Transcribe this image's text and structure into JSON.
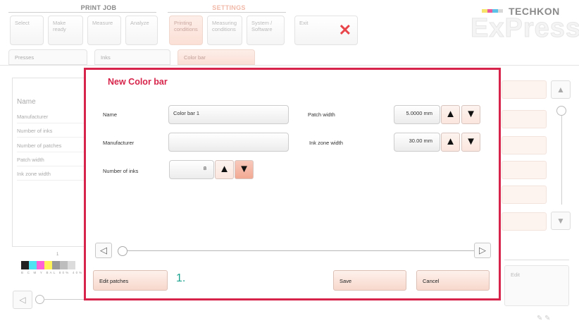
{
  "menu": {
    "print_job_title": "PRINT JOB",
    "settings_title": "SETTINGS",
    "print_job_items": [
      "Select",
      "Make ready",
      "Measure",
      "Analyze"
    ],
    "settings_items": [
      "Printing conditions",
      "Measuring conditions",
      "System / Software"
    ],
    "exit_label": "Exit"
  },
  "logo": {
    "brand": "TECHKON",
    "product": "ExPresso"
  },
  "tabs": [
    "Presses",
    "Inks",
    "Color bar"
  ],
  "background_list": {
    "header": "Name",
    "rows": [
      "Manufacturer",
      "Number of inks",
      "Number of patches",
      "Patch width",
      "Ink zone width"
    ],
    "ruler_number": "1",
    "swatch_labels": "B C M Y BAL 80% 40%",
    "edit_label": "Edit"
  },
  "modal": {
    "title": "New Color bar",
    "name_label": "Name",
    "name_value": "Color bar 1",
    "manufacturer_label": "Manufacturer",
    "manufacturer_value": "",
    "inks_label": "Number of inks",
    "inks_value": "8",
    "patch_width_label": "Patch width",
    "patch_width_value": "5.0000 mm",
    "zone_width_label": "Ink zone width",
    "zone_width_value": "30.00 mm",
    "edit_patches": "Edit patches",
    "save": "Save",
    "cancel": "Cancel",
    "annotation": "1."
  },
  "colors": {
    "modal_border": "#d6244a",
    "annotation": "#1aa38f",
    "exit_x": "#e8454a"
  }
}
